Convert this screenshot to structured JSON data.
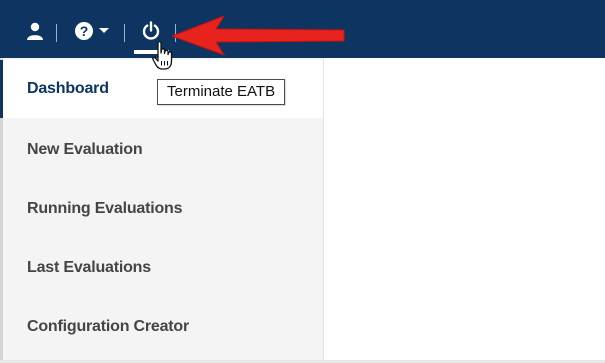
{
  "topbar": {
    "background_color": "#0e3461",
    "icons": {
      "user": "user-icon",
      "help": "help-icon",
      "dropdown": "chevron-down-icon",
      "power": "power-icon"
    }
  },
  "annotation": {
    "arrow_color": "#e8221c"
  },
  "tooltip": {
    "text": "Terminate EATB"
  },
  "sidebar": {
    "items": [
      {
        "label": "Dashboard",
        "active": true
      },
      {
        "label": "New Evaluation",
        "active": false
      },
      {
        "label": "Running Evaluations",
        "active": false
      },
      {
        "label": "Last Evaluations",
        "active": false
      },
      {
        "label": "Configuration Creator",
        "active": false
      }
    ]
  }
}
